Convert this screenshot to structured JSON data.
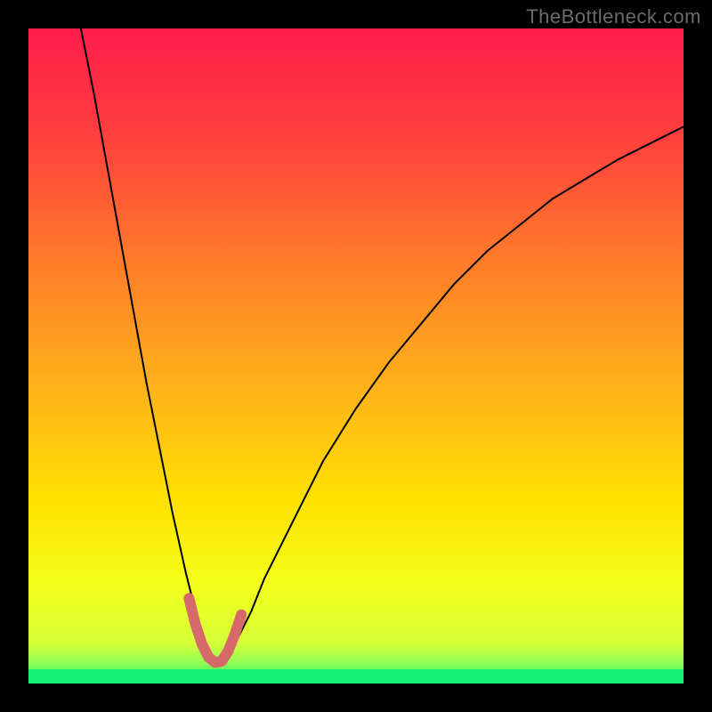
{
  "watermark": "TheBottleneck.com",
  "chart_data": {
    "type": "line",
    "title": "",
    "xlabel": "",
    "ylabel": "",
    "xlim": [
      0,
      100
    ],
    "ylim": [
      0,
      100
    ],
    "background_gradient": {
      "top_color": "#ff1e4b",
      "mid_color": "#ffd000",
      "green_band_color": "#15f07a",
      "green_band_y": [
        0,
        3
      ]
    },
    "series": [
      {
        "name": "curve",
        "stroke": "#000000",
        "stroke_width": 2,
        "x": [
          8,
          10,
          12,
          14,
          16,
          18,
          20,
          22,
          24,
          26,
          27,
          28,
          29,
          30,
          32,
          34,
          36,
          40,
          45,
          50,
          55,
          60,
          65,
          70,
          75,
          80,
          85,
          90,
          95,
          100
        ],
        "y": [
          100,
          90,
          79,
          68,
          57,
          46,
          36,
          26,
          17,
          9,
          6,
          4,
          3,
          4,
          7,
          11,
          16,
          24,
          34,
          42,
          49,
          55,
          61,
          66,
          70,
          74,
          77,
          80,
          82.5,
          85
        ]
      },
      {
        "name": "highlight-min",
        "stroke": "#d66a6a",
        "stroke_width": 12,
        "linecap": "round",
        "x": [
          24.5,
          25.5,
          26.5,
          27.5,
          28.5,
          29.5,
          30.5,
          31.5,
          32.5
        ],
        "y": [
          13,
          9,
          6,
          4,
          3.2,
          3.4,
          5,
          7.5,
          10.5
        ]
      }
    ],
    "minimum_point": {
      "x": 28.5,
      "y": 3
    }
  }
}
